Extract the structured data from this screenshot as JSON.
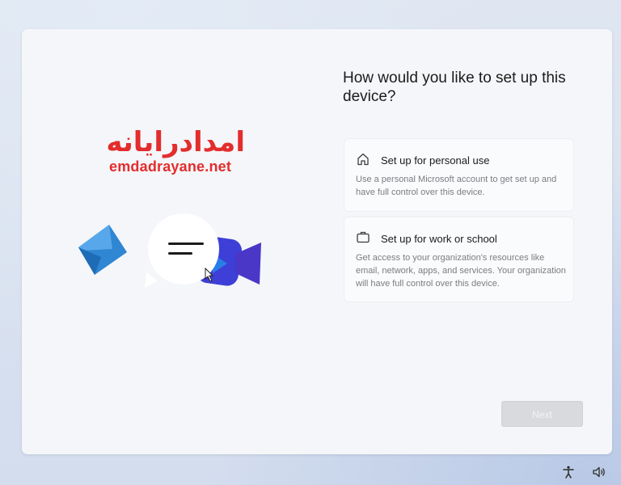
{
  "brand": {
    "name_fa": "امدادرایانه",
    "domain": "emdadrayane.net"
  },
  "setup": {
    "question": "How would you like to set up this device?",
    "options": [
      {
        "icon": "home-icon",
        "title": "Set up for personal use",
        "description": "Use a personal Microsoft account to get set up and have full control over this device."
      },
      {
        "icon": "briefcase-icon",
        "title": "Set up for work or school",
        "description": "Get access to your organization's resources like email, network, apps, and services. Your organization will have full control over this device."
      }
    ],
    "next_label": "Next"
  },
  "taskbar": {
    "icons": [
      "accessibility-icon",
      "volume-icon"
    ]
  },
  "colors": {
    "brand_red": "#e32d2d",
    "panel_bg": "#f4f6f9",
    "disabled_button": "#d9dadd"
  }
}
